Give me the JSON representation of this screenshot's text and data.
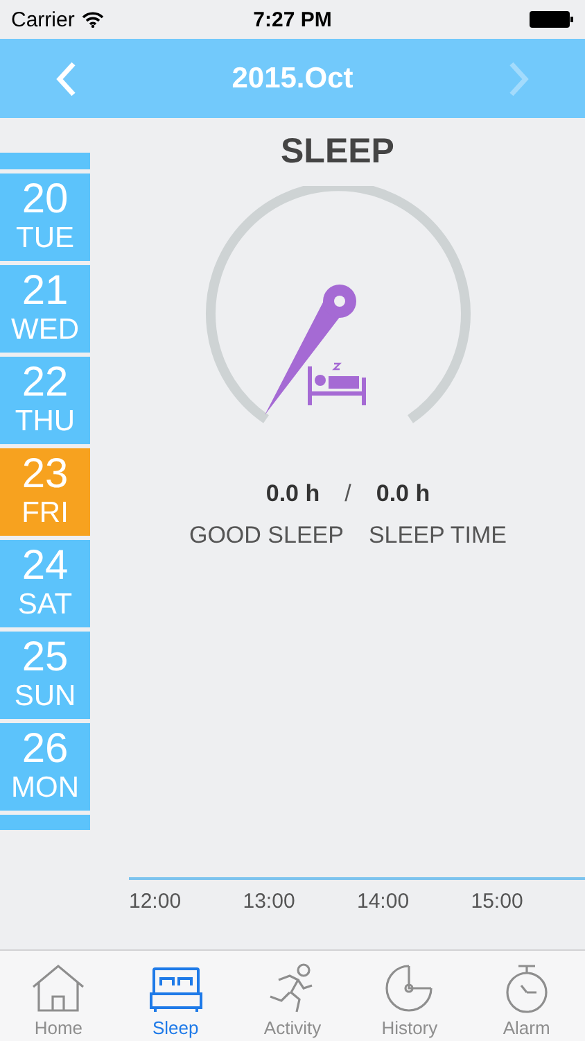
{
  "status_bar": {
    "carrier": "Carrier",
    "time": "7:27 PM"
  },
  "header": {
    "title": "2015.Oct",
    "prev_disabled": false,
    "next_disabled": true
  },
  "days": [
    {
      "day": "20",
      "weekday": "TUE",
      "selected": false
    },
    {
      "day": "21",
      "weekday": "WED",
      "selected": false
    },
    {
      "day": "22",
      "weekday": "THU",
      "selected": false
    },
    {
      "day": "23",
      "weekday": "FRI",
      "selected": true
    },
    {
      "day": "24",
      "weekday": "SAT",
      "selected": false
    },
    {
      "day": "25",
      "weekday": "SUN",
      "selected": false
    },
    {
      "day": "26",
      "weekday": "MON",
      "selected": false
    }
  ],
  "sleep": {
    "title": "SLEEP",
    "good_sleep": "0.0 h",
    "separator": "/",
    "sleep_time": "0.0 h",
    "good_sleep_label": "GOOD SLEEP",
    "sleep_time_label": "SLEEP TIME"
  },
  "timeline": {
    "ticks": [
      "12:00",
      "13:00",
      "14:00",
      "15:00"
    ]
  },
  "tabs": [
    {
      "label": "Home",
      "kind": "home",
      "selected": false
    },
    {
      "label": "Sleep",
      "kind": "sleep",
      "selected": true
    },
    {
      "label": "Activity",
      "kind": "activity",
      "selected": false
    },
    {
      "label": "History",
      "kind": "history",
      "selected": false
    },
    {
      "label": "Alarm",
      "kind": "alarm",
      "selected": false
    }
  ]
}
